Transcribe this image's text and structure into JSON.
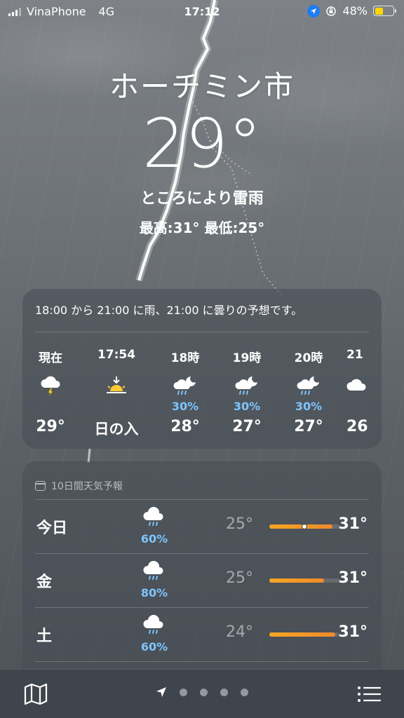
{
  "status": {
    "carrier": "VinaPhone",
    "network": "4G",
    "time": "17:12",
    "battery": "48%"
  },
  "header": {
    "city": "ホーチミン市",
    "temperature": "29°",
    "condition": "ところにより雷雨",
    "hilo": "最高:31°  最低:25°"
  },
  "hourly": {
    "summary": "18:00 から 21:00 に雨、21:00 に曇りの予想です。",
    "items": [
      {
        "label": "現在",
        "icon": "thunderstorm-icon",
        "pop": "",
        "temp": "29°"
      },
      {
        "label": "17:54",
        "icon": "sunset-icon",
        "pop": "",
        "temp": "日の入"
      },
      {
        "label": "18時",
        "icon": "rain-moon-icon",
        "pop": "30%",
        "temp": "28°"
      },
      {
        "label": "19時",
        "icon": "rain-moon-icon",
        "pop": "30%",
        "temp": "27°"
      },
      {
        "label": "20時",
        "icon": "rain-moon-icon",
        "pop": "30%",
        "temp": "27°"
      },
      {
        "label": "21",
        "icon": "cloud-icon",
        "pop": "",
        "temp": "26"
      }
    ]
  },
  "daily": {
    "title": "10日間天気予報",
    "items": [
      {
        "day": "今日",
        "icon": "rain-icon",
        "pop": "60%",
        "low": "25°",
        "high": "31°",
        "range_start": 0.0,
        "range_end": 0.9,
        "current": 0.5
      },
      {
        "day": "金",
        "icon": "rain-icon",
        "pop": "80%",
        "low": "25°",
        "high": "31°",
        "range_start": 0.0,
        "range_end": 0.78
      },
      {
        "day": "土",
        "icon": "rain-icon",
        "pop": "60%",
        "low": "24°",
        "high": "31°",
        "range_start": 0.0,
        "range_end": 0.94
      }
    ]
  },
  "colors": {
    "precip": "#7ec4ff",
    "range": "#f5a623",
    "battery": "#ffd60a",
    "location": "#1e7cf5"
  }
}
